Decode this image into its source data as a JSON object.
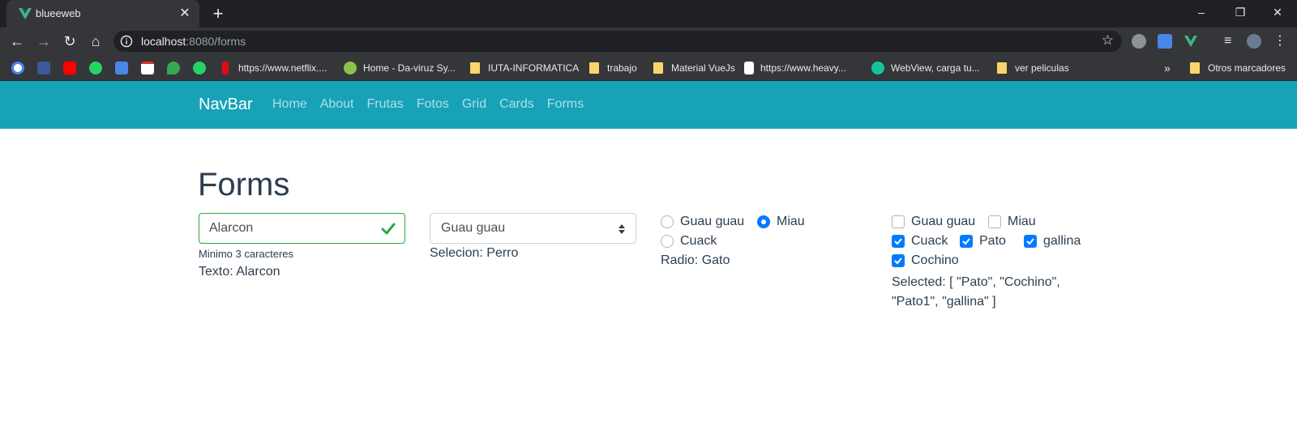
{
  "browser": {
    "tab_title": "blueeweb",
    "url_host": "localhost",
    "url_rest": ":8080/forms",
    "bookmarks": [
      "https://www.netflix....",
      "Home - Da-viruz Sy...",
      "IUTA-INFORMATICA",
      "trabajo",
      "Material VueJs",
      "https://www.heavy...",
      "WebView, carga tu...",
      "ver peliculas"
    ],
    "other_bookmarks": "Otros marcadores",
    "overflow": "»"
  },
  "navbar": {
    "brand": "NavBar",
    "links": [
      "Home",
      "About",
      "Frutas",
      "Fotos",
      "Grid",
      "Cards",
      "Forms"
    ]
  },
  "page": {
    "title": "Forms",
    "text_field": {
      "value": "Alarcon",
      "help": "Minimo 3 caracteres",
      "output": "Texto: Alarcon"
    },
    "select_field": {
      "value": "Guau guau",
      "output": "Selecion: Perro"
    },
    "radios": {
      "options": [
        "Guau guau",
        "Miau",
        "Cuack"
      ],
      "checked": [
        false,
        true,
        false
      ],
      "output": "Radio: Gato"
    },
    "checkboxes": {
      "options": [
        "Guau guau",
        "Miau",
        "Cuack",
        "Pato",
        "gallina",
        "Cochino"
      ],
      "checked": [
        false,
        false,
        true,
        true,
        true,
        true
      ],
      "output": "Selected: [ \"Pato\", \"Cochino\", \"Pato1\", \"gallina\" ]"
    }
  },
  "colors": {
    "navbar": "#17a2b8",
    "primary": "#007bff",
    "valid": "#28a745",
    "text": "#2c3e50"
  }
}
